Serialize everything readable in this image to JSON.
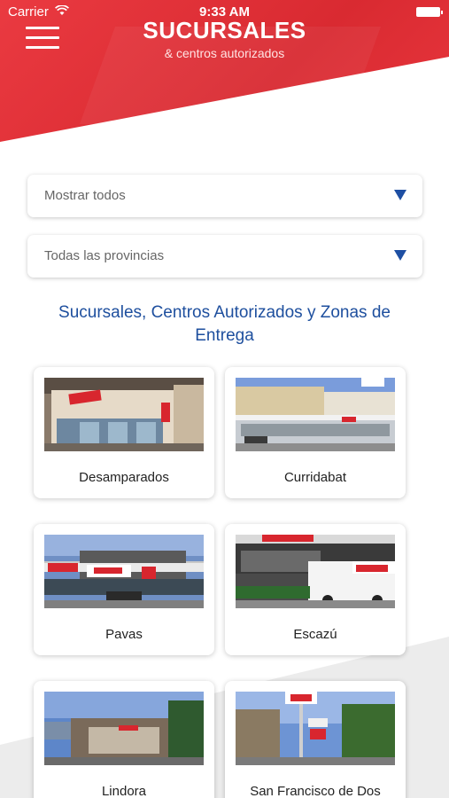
{
  "status_bar": {
    "carrier": "Carrier",
    "time": "9:33 AM"
  },
  "header": {
    "title": "SUCURSALES",
    "subtitle": "& centros autorizados"
  },
  "filters": {
    "type": {
      "value": "Mostrar todos"
    },
    "province": {
      "value": "Todas las provincias"
    }
  },
  "section_heading": "Sucursales, Centros Autorizados y Zonas de Entrega",
  "branches": [
    {
      "name": "Desamparados"
    },
    {
      "name": "Curridabat"
    },
    {
      "name": "Pavas"
    },
    {
      "name": "Escazú"
    },
    {
      "name": "Lindora"
    },
    {
      "name": "San Francisco de Dos"
    }
  ],
  "colors": {
    "brand_red": "#e0323a",
    "accent_blue": "#1e4fa3"
  },
  "icons": {
    "menu": "hamburger-menu-icon",
    "dropdown": "chevron-down-icon",
    "wifi": "wifi-icon",
    "battery": "battery-icon"
  }
}
